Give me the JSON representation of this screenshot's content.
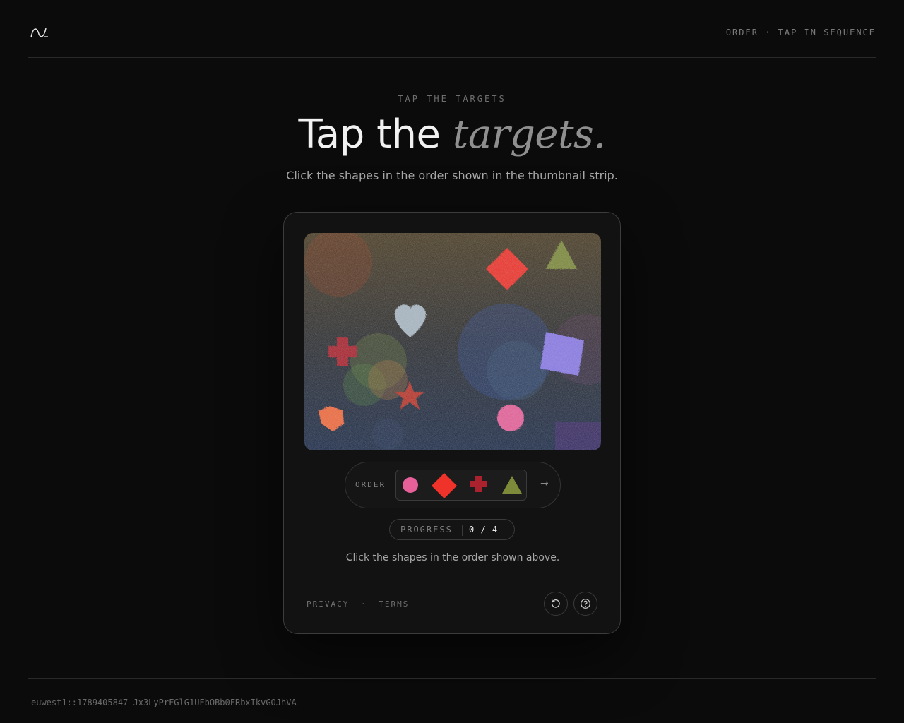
{
  "header": {
    "logo_icon": "wave-logo-icon",
    "mode_text": "ORDER · TAP IN SEQUENCE"
  },
  "hero": {
    "eyebrow": "TAP THE TARGETS",
    "title_plain": "Tap the",
    "title_emphasis": "targets.",
    "subtitle": "Click the shapes in the order shown in the thumbnail strip."
  },
  "canvas": {
    "background_top": "#4a3c24",
    "background_bottom": "#1d2c4a",
    "shapes": [
      {
        "name": "diamond",
        "color": "#f0332a"
      },
      {
        "name": "triangle",
        "color": "#7c8a3a"
      },
      {
        "name": "heart",
        "color": "#a9b8c4"
      },
      {
        "name": "cross",
        "color": "#a9222e"
      },
      {
        "name": "square",
        "color": "#8a7ae8"
      },
      {
        "name": "star",
        "color": "#b8362a"
      },
      {
        "name": "circle",
        "color": "#e8609a"
      },
      {
        "name": "pentagon",
        "color": "#f26a3c"
      }
    ]
  },
  "order": {
    "label": "ORDER",
    "sequence": [
      {
        "shape": "circle",
        "color": "#e8609a"
      },
      {
        "shape": "diamond",
        "color": "#f0332a"
      },
      {
        "shape": "cross",
        "color": "#a9222e"
      },
      {
        "shape": "triangle",
        "color": "#7c8a3a"
      }
    ],
    "arrow": "→"
  },
  "progress": {
    "label": "PROGRESS",
    "value": "0 / 4",
    "completed": 0,
    "total": 4
  },
  "instruction": "Click the shapes in the order shown above.",
  "links": {
    "privacy": "PRIVACY",
    "separator": "·",
    "terms": "TERMS"
  },
  "buttons": {
    "refresh_icon": "refresh-icon",
    "help_icon": "help-icon"
  },
  "footer": {
    "session_id": "euwest1::1789405847-Jx3LyPrFGlG1UFbOBb0FRbxIkvGOJhVA"
  }
}
